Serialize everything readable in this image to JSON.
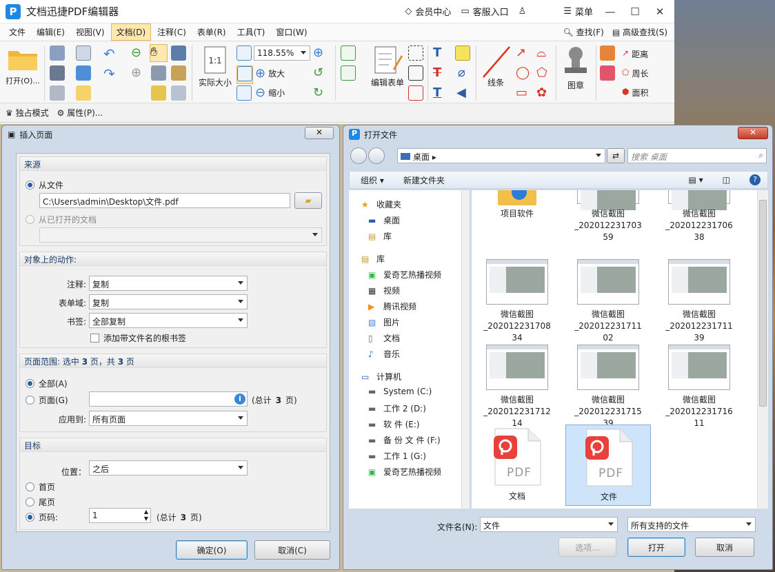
{
  "app": {
    "title": "文档迅捷PDF编辑器",
    "vip": "会员中心",
    "service": "客服入口",
    "menu_label": "菜单"
  },
  "menubar": {
    "items": [
      "文件",
      "编辑(E)",
      "视图(V)",
      "文档(D)",
      "注释(C)",
      "表单(R)",
      "工具(T)",
      "窗口(W)"
    ],
    "active_index": 3,
    "find": "查找(F)",
    "adv_find": "高级查找(S)"
  },
  "ribbon": {
    "open": "打开(O)...",
    "actual_size": "实际大小",
    "zoom": "118.55%",
    "zoom_in": "放大",
    "zoom_out": "缩小",
    "edit_form": "编辑表单",
    "line": "线条",
    "stamp": "图章",
    "distance": "距离",
    "perimeter": "周长",
    "area": "面积"
  },
  "subbar": {
    "exclusive": "独占模式",
    "properties": "属性(P)..."
  },
  "insert_dialog": {
    "title": "插入页面",
    "source": {
      "header": "来源",
      "from_file": "从文件",
      "path": "C:\\Users\\admin\\Desktop\\文件.pdf",
      "from_opened": "从已打开的文档"
    },
    "actions": {
      "header": "对象上的动作:",
      "annot_label": "注释:",
      "annot_value": "复制",
      "form_label": "表单域:",
      "form_value": "复制",
      "bookmark_label": "书签:",
      "bookmark_value": "全部复制",
      "add_root": "添加带文件名的根书签"
    },
    "range": {
      "header_a": "页面范围: 选中 ",
      "sel": "3",
      "header_b": " 页，共 ",
      "total": "3",
      "header_c": " 页",
      "all": "全部(A)",
      "pages": "页面(G)",
      "pages_total_a": "(总计 ",
      "pages_total_b": "3",
      "pages_total_c": " 页)",
      "apply_label": "应用到:",
      "apply_value": "所有页面"
    },
    "target": {
      "header": "目标",
      "pos_label": "位置：",
      "pos_value": "之后",
      "first": "首页",
      "last": "尾页",
      "pageno": "页码:",
      "pageno_value": "1",
      "total_a": "(总计 ",
      "total_b": "3",
      "total_c": " 页)"
    },
    "ok": "确定(O)",
    "cancel": "取消(C)"
  },
  "open_dialog": {
    "title": "打开文件",
    "address": "桌面",
    "search_placeholder": "搜索 桌面",
    "organize": "组织",
    "new_folder": "新建文件夹",
    "nav": [
      {
        "label": "收藏夹",
        "icon": "star-icon",
        "level": 0
      },
      {
        "label": "桌面",
        "icon": "desktop-icon",
        "level": 1
      },
      {
        "label": "库",
        "icon": "library-icon",
        "level": 1
      },
      {
        "label": "库",
        "icon": "library-icon",
        "level": 0
      },
      {
        "label": "爱奇艺热播视频",
        "icon": "iqiyi-icon",
        "level": 1
      },
      {
        "label": "视频",
        "icon": "video-icon",
        "level": 1
      },
      {
        "label": "腾讯视频",
        "icon": "tencent-video-icon",
        "level": 1
      },
      {
        "label": "图片",
        "icon": "picture-icon",
        "level": 1
      },
      {
        "label": "文档",
        "icon": "document-icon",
        "level": 1
      },
      {
        "label": "音乐",
        "icon": "music-icon",
        "level": 1
      },
      {
        "label": "计算机",
        "icon": "computer-icon",
        "level": 0
      },
      {
        "label": "System (C:)",
        "icon": "drive-icon",
        "level": 1
      },
      {
        "label": "工作 2 (D:)",
        "icon": "drive-icon",
        "level": 1
      },
      {
        "label": "软 件 (E:)",
        "icon": "drive-icon",
        "level": 1
      },
      {
        "label": "备 份 文 件 (F:)",
        "icon": "drive-icon",
        "level": 1
      },
      {
        "label": "工作 1 (G:)",
        "icon": "drive-icon",
        "level": 1
      },
      {
        "label": "爱奇艺热播视频",
        "icon": "iqiyi-icon",
        "level": 1
      }
    ],
    "files": [
      {
        "name1": "项目软件",
        "name2": "",
        "name3": "",
        "kind": "folder"
      },
      {
        "name1": "微信截图",
        "name2": "_202012231703",
        "name3": "59",
        "kind": "shot"
      },
      {
        "name1": "微信截图",
        "name2": "_202012231706",
        "name3": "38",
        "kind": "shot"
      },
      {
        "name1": "微信截图",
        "name2": "_202012231708",
        "name3": "34",
        "kind": "shot"
      },
      {
        "name1": "微信截图",
        "name2": "_202012231711",
        "name3": "02",
        "kind": "shot"
      },
      {
        "name1": "微信截图",
        "name2": "_202012231711",
        "name3": "39",
        "kind": "shot"
      },
      {
        "name1": "微信截图",
        "name2": "_202012231712",
        "name3": "14",
        "kind": "shot"
      },
      {
        "name1": "微信截图",
        "name2": "_202012231715",
        "name3": "39",
        "kind": "shot"
      },
      {
        "name1": "微信截图",
        "name2": "_202012231716",
        "name3": "11",
        "kind": "shot"
      },
      {
        "name1": "文档",
        "name2": "",
        "name3": "",
        "kind": "pdf"
      },
      {
        "name1": "文件",
        "name2": "",
        "name3": "",
        "kind": "pdf",
        "selected": true
      }
    ],
    "filename_label": "文件名(N):",
    "filename_value": "文件",
    "filter_value": "所有支持的文件",
    "options": "选项...",
    "open": "打开",
    "cancel": "取消",
    "pdf_text": "PDF"
  },
  "colors": {
    "accent": "#2a5ea8",
    "pdf_red": "#e8413c",
    "selection": "#cde4fa"
  }
}
